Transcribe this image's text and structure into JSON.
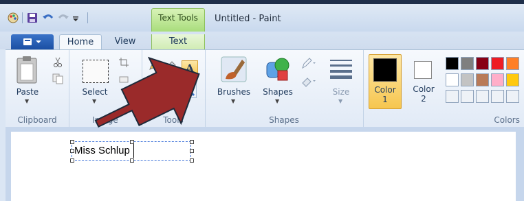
{
  "title_bar": {
    "context_tab_label": "Text Tools",
    "document_title": "Untitled - Paint"
  },
  "tabs": {
    "home": "Home",
    "view": "View",
    "text": "Text"
  },
  "ribbon": {
    "clipboard": {
      "paste": "Paste",
      "group": "Clipboard"
    },
    "image": {
      "select": "Select",
      "group": "Image"
    },
    "tools": {
      "group": "Tools",
      "text_tool_letter": "A"
    },
    "shapes": {
      "brushes": "Brushes",
      "shapes": "Shapes",
      "size": "Size",
      "group": "Shapes"
    },
    "colors": {
      "color1": "Color\n1",
      "color2": "Color\n2",
      "group": "Colors",
      "color1_value": "#000000",
      "color2_value": "#ffffff",
      "palette_row1": [
        "#000000",
        "#7f7f7f",
        "#880015",
        "#ed1c24",
        "#ff7f27"
      ],
      "palette_row2": [
        "#ffffff",
        "#c3c3c3",
        "#b97a57",
        "#ffaec9",
        "#ffc90e"
      ]
    }
  },
  "canvas": {
    "text_box_content": "Miss Schlup"
  },
  "annotation": {
    "arrow_color": "#9a2a2a"
  }
}
